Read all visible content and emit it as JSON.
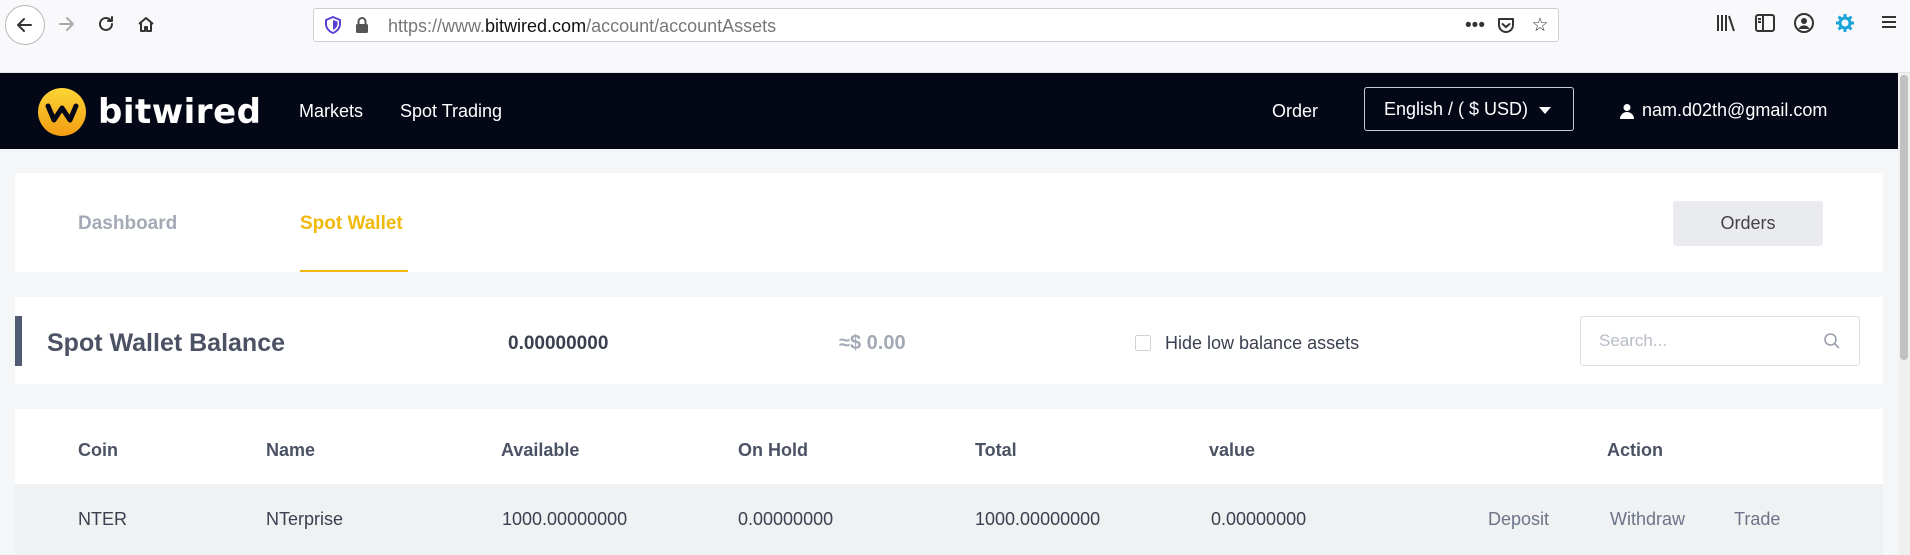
{
  "browser": {
    "url_prefix": "https://www.",
    "url_domain": "bitwired.com",
    "url_path": "/account/accountAssets",
    "icons": [
      "back-icon",
      "forward-icon",
      "reload-icon",
      "home-icon",
      "shield-icon",
      "lock-icon",
      "more-icon",
      "pocket-icon",
      "star-icon",
      "library-icon",
      "sidebar-icon",
      "account-icon",
      "extension-icon",
      "menu-icon"
    ]
  },
  "header": {
    "brand": "bitwired",
    "nav": [
      "Markets",
      "Spot Trading"
    ],
    "order_link": "Order",
    "language": "English / ( $ USD)",
    "user_email": "nam.d02th@gmail.com"
  },
  "tabs": {
    "dashboard": "Dashboard",
    "spot_wallet": "Spot Wallet",
    "orders_button": "Orders"
  },
  "balance": {
    "title": "Spot Wallet Balance",
    "amount": "0.00000000",
    "usd": "≈$ 0.00",
    "hide_low_label": "Hide low balance assets",
    "hide_low_checked": false,
    "search_placeholder": "Search...",
    "search_value": ""
  },
  "table": {
    "columns": [
      "Coin",
      "Name",
      "Available",
      "On Hold",
      "Total",
      "value",
      "Action"
    ],
    "rows": [
      {
        "coin": "NTER",
        "name": "NTerprise",
        "available": "1000.00000000",
        "on_hold": "0.00000000",
        "total": "1000.00000000",
        "value": "0.00000000",
        "actions": [
          "Deposit",
          "Withdraw",
          "Trade"
        ]
      }
    ]
  },
  "colors": {
    "header_bg": "#040816",
    "accent": "#f0b90b",
    "page_bg": "#f5f6f8"
  }
}
